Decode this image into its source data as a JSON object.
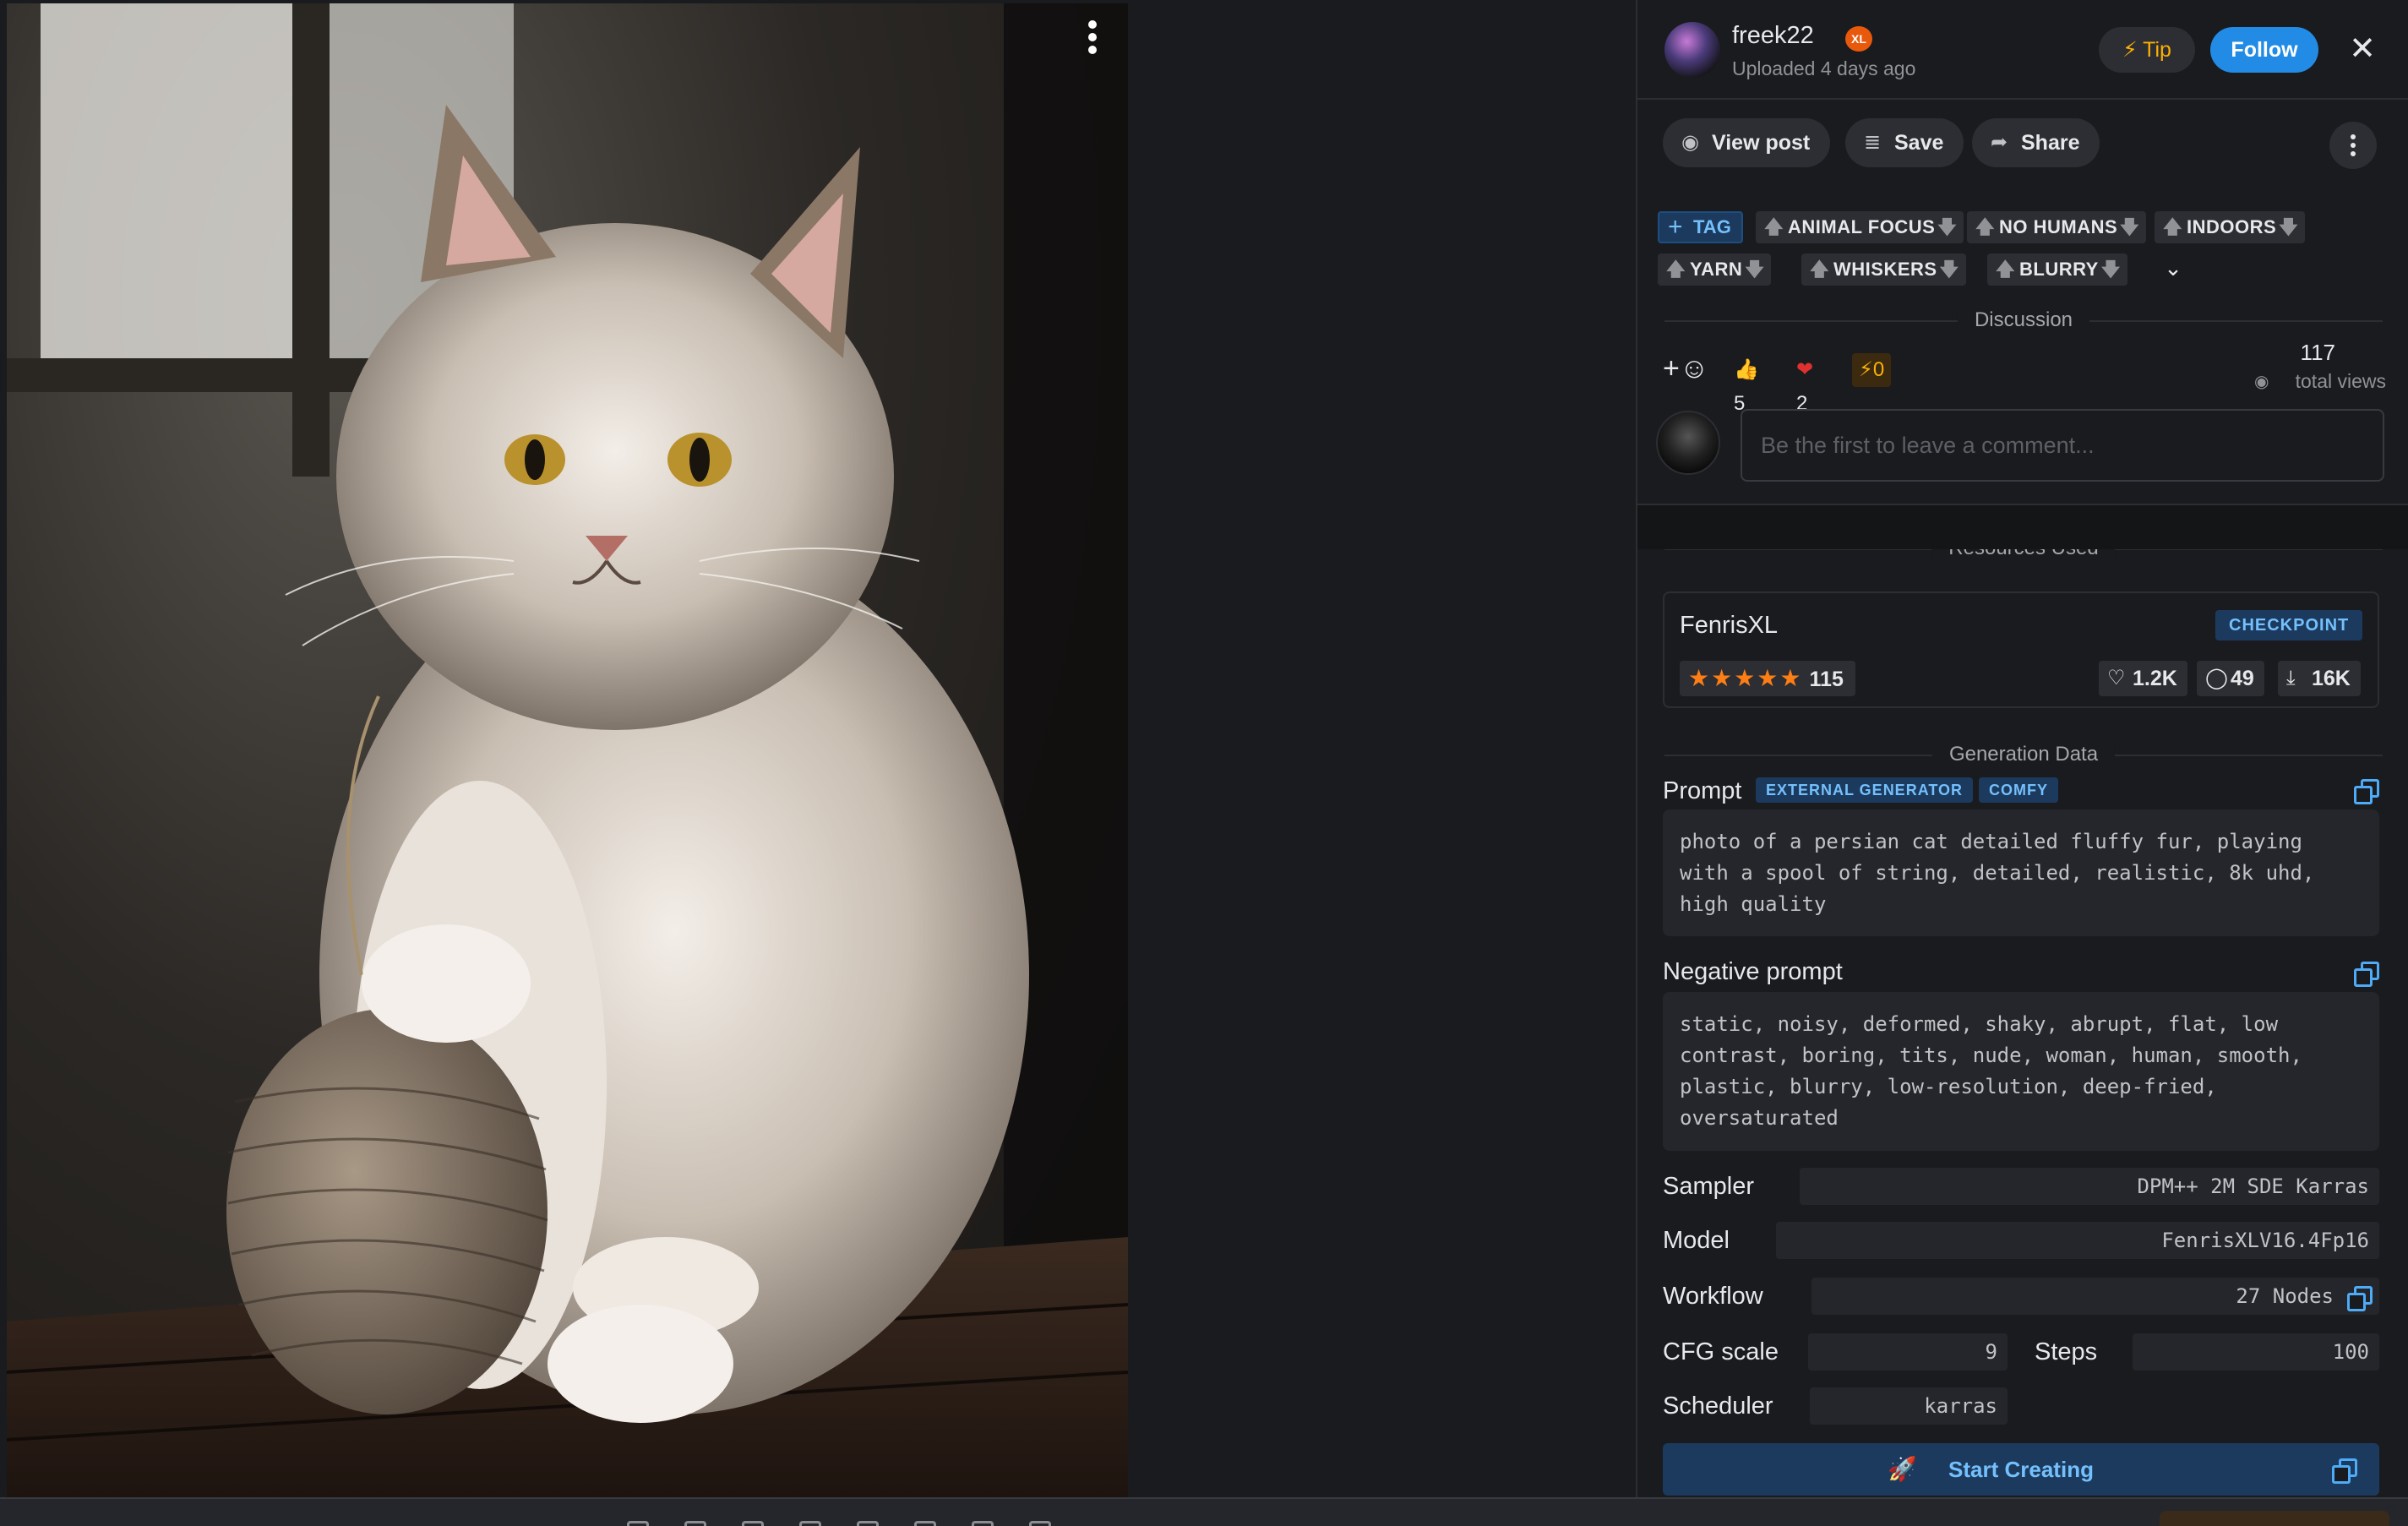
{
  "author": {
    "name": "freek22",
    "badge": "XL",
    "uploaded": "Uploaded 4 days ago"
  },
  "header": {
    "tip_label": "Tip",
    "follow_label": "Follow",
    "close_icon": "close-icon"
  },
  "actions": {
    "view_post": "View post",
    "save": "Save",
    "share": "Share"
  },
  "tags": {
    "add_label": "TAG",
    "items": [
      "ANIMAL FOCUS",
      "NO HUMANS",
      "INDOORS",
      "YARN",
      "WHISKERS",
      "BLURRY"
    ]
  },
  "discussion": {
    "title": "Discussion",
    "reactions": {
      "thumbs": "5",
      "heart": "2",
      "bolt": "0"
    },
    "views": "117",
    "views_label": "total views",
    "comment_placeholder": "Be the first to leave a comment..."
  },
  "resources": {
    "title": "Resources Used",
    "name": "FenrisXL",
    "type": "CHECKPOINT",
    "rating_count": "115",
    "rating": 5,
    "likes": "1.2K",
    "comments": "49",
    "downloads": "16K"
  },
  "generation": {
    "title": "Generation Data",
    "prompt_label": "Prompt",
    "chips": [
      "EXTERNAL GENERATOR",
      "COMFY"
    ],
    "prompt": "photo of a persian cat detailed fluffy fur, playing with a spool of string, detailed, realistic, 8k uhd, high quality",
    "negative_label": "Negative prompt",
    "negative": "static, noisy, deformed, shaky, abrupt, flat, low contrast, boring, tits, nude, woman, human, smooth, plastic, blurry, low-resolution, deep-fried, oversaturated",
    "sampler_label": "Sampler",
    "sampler": "DPM++ 2M SDE Karras",
    "model_label": "Model",
    "model": "FenrisXLV16.4Fp16",
    "workflow_label": "Workflow",
    "workflow": "27 Nodes",
    "cfg_label": "CFG scale",
    "cfg": "9",
    "steps_label": "Steps",
    "steps": "100",
    "scheduler_label": "Scheduler",
    "scheduler": "karras"
  },
  "start_creating": "Start Creating",
  "colors": {
    "accent": "#228be6",
    "tip": "#fab005",
    "chip_bg": "#1c3a5e",
    "chip_fg": "#74c0fc"
  }
}
